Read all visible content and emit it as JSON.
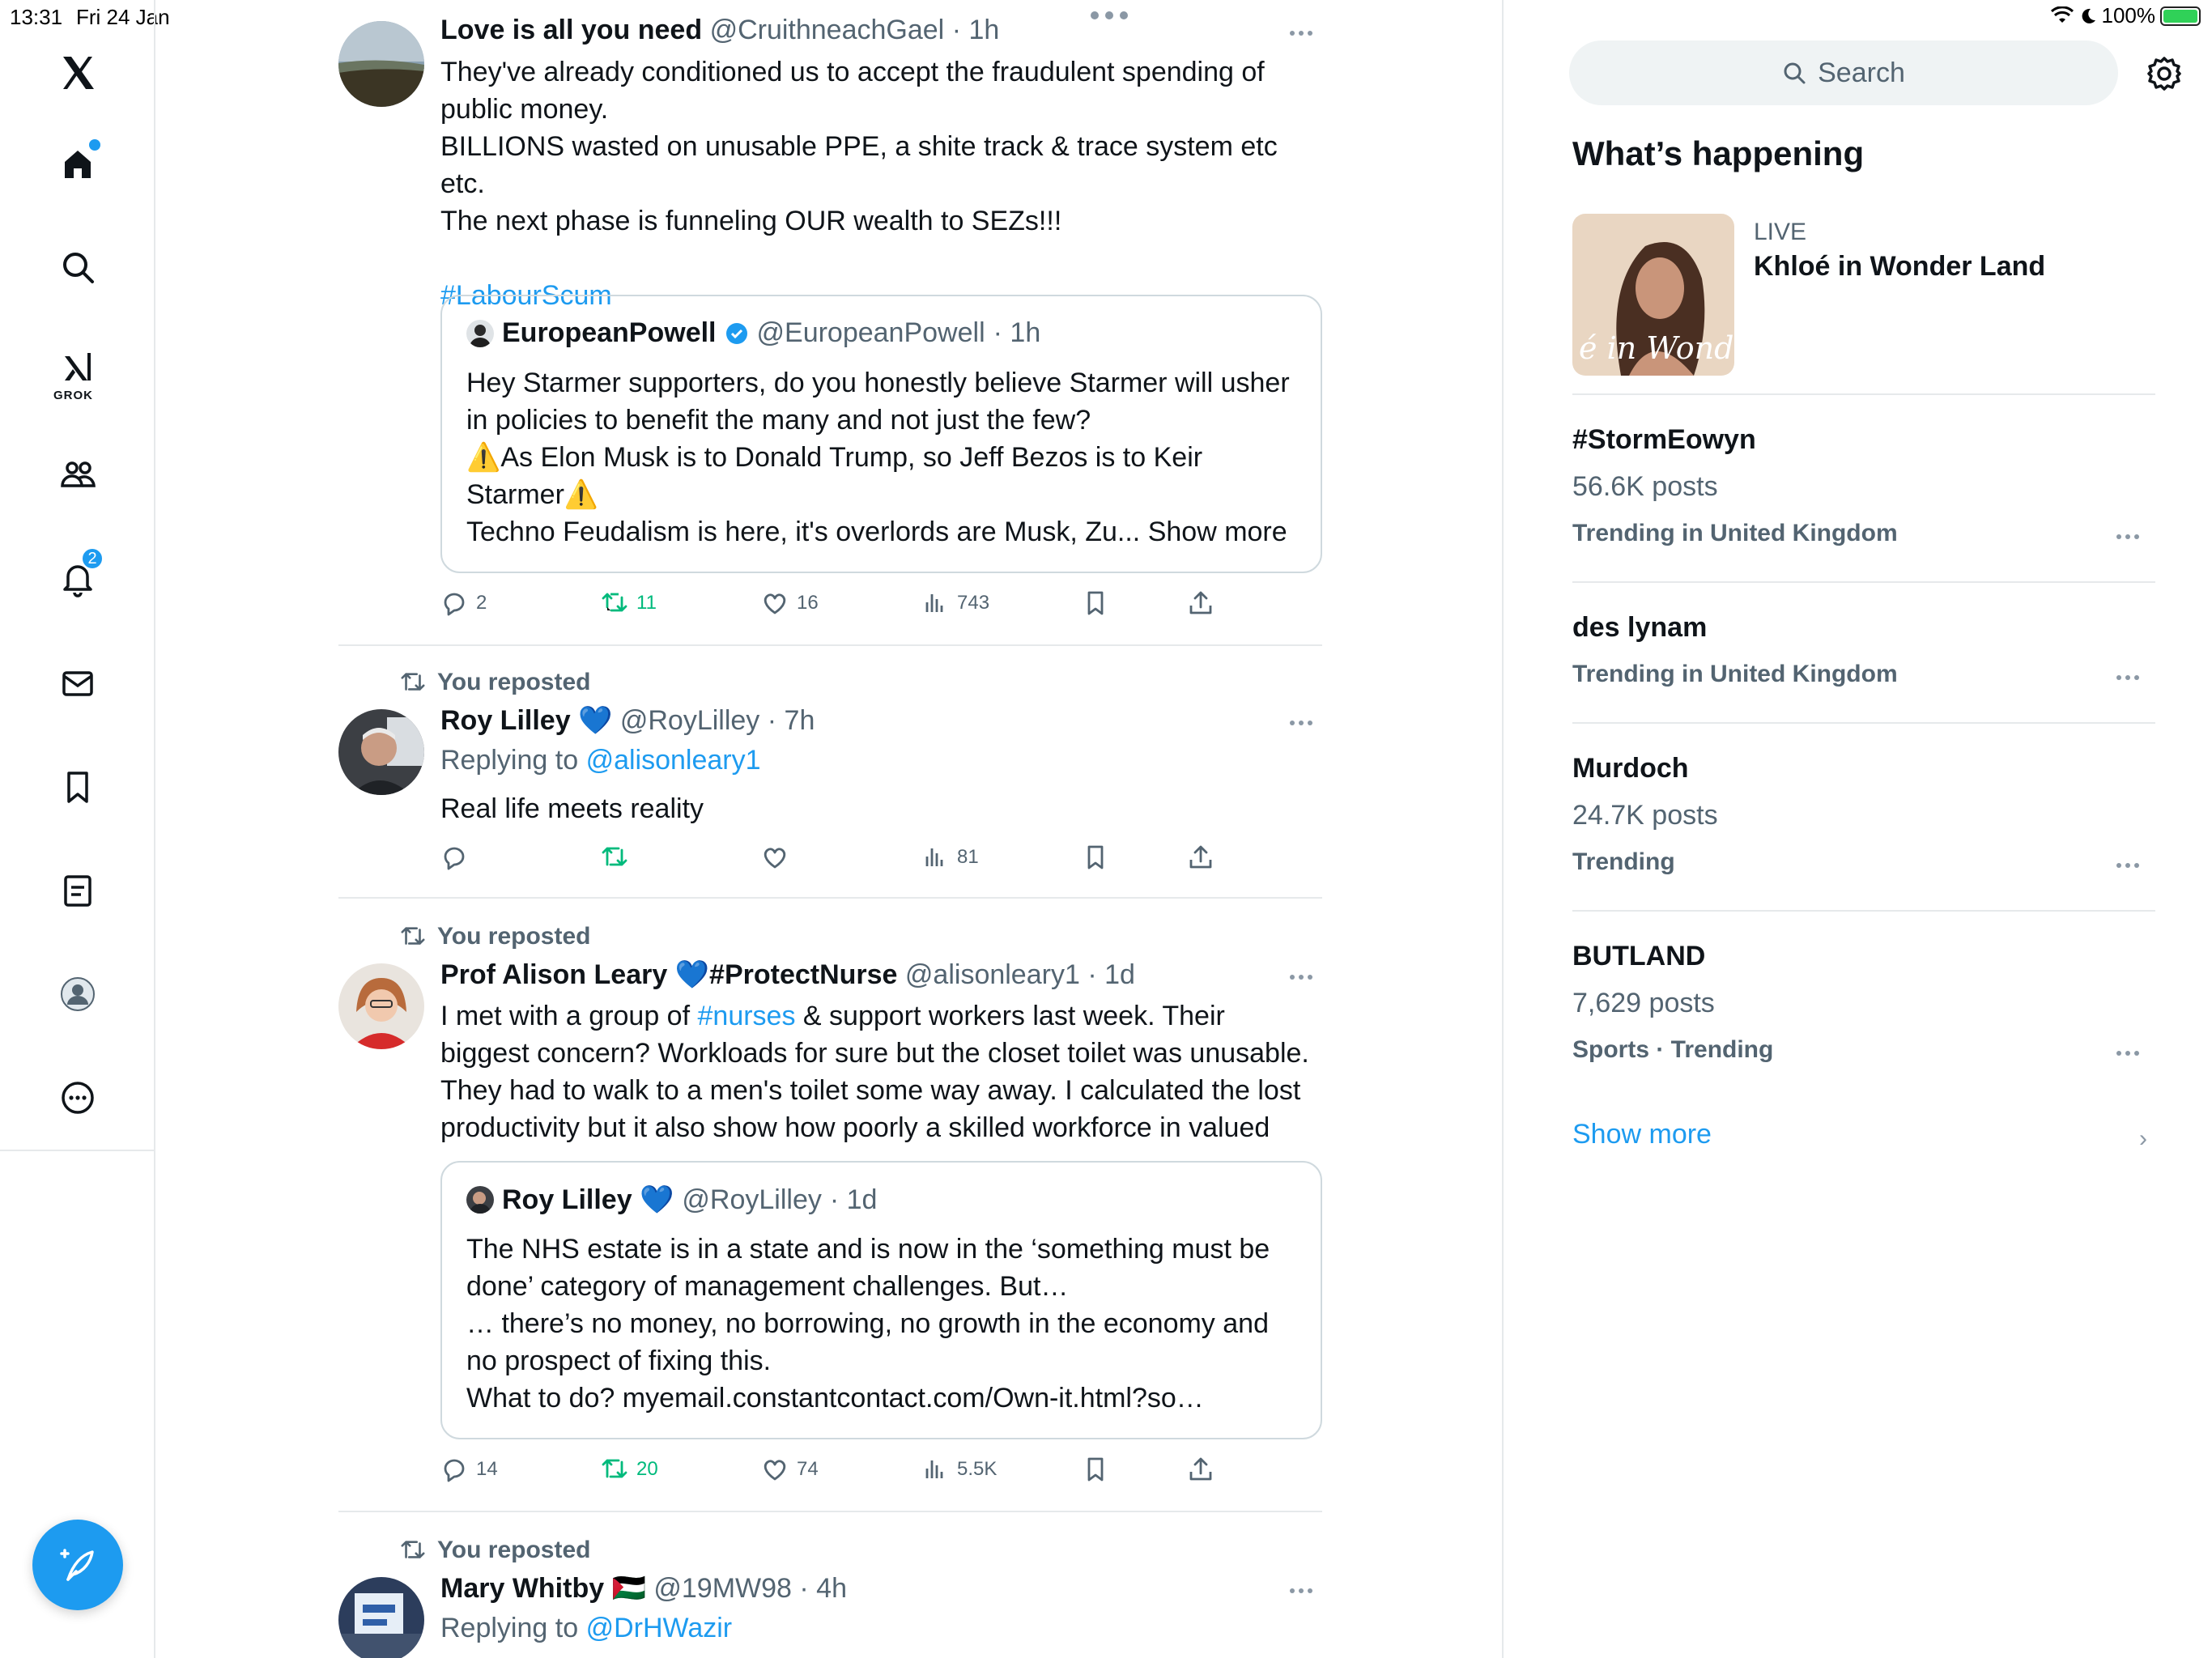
{
  "status_bar": {
    "time": "13:31",
    "date": "Fri 24 Jan",
    "battery": "100%"
  },
  "nav": {
    "grok_label": "GROK",
    "notifications_badge": "2"
  },
  "feed": {
    "tweet1": {
      "name": "Love is all you need",
      "handle": "@CruithneachGael",
      "time": "· 1h",
      "lines": [
        "They've already conditioned us to accept the fraudulent spending of",
        "public money.",
        "BILLIONS wasted on unusable PPE, a shite track & trace system etc etc.",
        "The next phase is funneling OUR wealth to SEZs!!!"
      ],
      "hashtag": "#LabourScum",
      "quote": {
        "name": "EuropeanPowell",
        "handle": "@EuropeanPowell",
        "time": "· 1h",
        "lines": [
          "Hey Starmer supporters, do you honestly believe Starmer will usher",
          "in policies to benefit the many and not just the few?",
          "⚠️As Elon Musk is to Donald Trump, so Jeff Bezos is to Keir",
          "Starmer⚠️",
          "Techno Feudalism is here, it's overlords are Musk, Zu... Show more"
        ]
      },
      "replies": "2",
      "reposts": "11",
      "likes": "16",
      "views": "743"
    },
    "tweet2": {
      "repost_label": "You reposted",
      "name": "Roy Lilley 💙",
      "handle": "@RoyLilley",
      "time": "· 7h",
      "replying_prefix": "Replying to",
      "replying_to": "@alisonleary1",
      "text": "Real life meets reality",
      "views": "81"
    },
    "tweet3": {
      "repost_label": "You reposted",
      "name": "Prof Alison Leary 💙#ProtectNurse",
      "handle": "@alisonleary1",
      "time": "· 1d",
      "line1_pre": "I met with a group of ",
      "line1_link": "#nurses",
      "line1_post": " & support workers last week. Their",
      "lines": [
        "biggest concern? Workloads for sure but the closet toilet was unusable.",
        "They had to walk to a men's toilet some way away. I calculated the lost",
        "productivity but it also show how poorly a skilled workforce in valued"
      ],
      "quote": {
        "name": "Roy Lilley 💙",
        "handle": "@RoyLilley",
        "time": "· 1d",
        "lines": [
          "The NHS estate is in a state and is now in the ‘something must be",
          "done’ category of management challenges. But…",
          "… there’s no money, no borrowing, no growth in the economy and",
          "no prospect of fixing this.",
          "What to do?  myemail.constantcontact.com/Own-it.html?so…"
        ]
      },
      "replies": "14",
      "reposts": "20",
      "likes": "74",
      "views": "5.5K"
    },
    "tweet4": {
      "repost_label": "You reposted",
      "name": "Mary Whitby 🇵🇸",
      "handle": "@19MW98",
      "time": "· 4h",
      "replying_prefix": "Replying to",
      "replying_to": "@DrHWazir"
    }
  },
  "sidebar": {
    "search_placeholder": "Search",
    "title": "What’s happening",
    "live": {
      "label": "LIVE",
      "title": "Khloé in Wonder Land",
      "image_text": "é in Wonder l"
    },
    "trends": [
      {
        "name": "#StormEowyn",
        "posts": "56.6K posts",
        "context": "Trending in United Kingdom"
      },
      {
        "name": "des lynam",
        "posts": "",
        "context": "Trending in United Kingdom"
      },
      {
        "name": "Murdoch",
        "posts": "24.7K posts",
        "context": "Trending"
      },
      {
        "name": "BUTLAND",
        "posts": "7,629 posts",
        "context": "Sports · Trending"
      }
    ],
    "show_more": "Show more"
  },
  "colors": {
    "accent": "#1d9bf0",
    "repost_green": "#00ba7c",
    "secondary_text": "#536471"
  }
}
